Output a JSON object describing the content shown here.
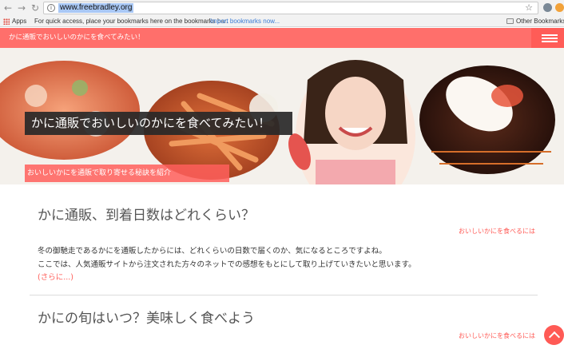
{
  "browser": {
    "url": "www.freebradley.org",
    "back_icon": "arrow-left-icon",
    "forward_icon": "arrow-right-icon",
    "reload_icon": "reload-icon",
    "info_icon": "info-icon",
    "star_icon": "star-icon"
  },
  "bookmarks": {
    "apps_label": "Apps",
    "hint": "For quick access, place your bookmarks here on the bookmarks bar.",
    "import_link": "Import bookmarks now...",
    "other_label": "Other Bookmarks"
  },
  "site": {
    "header_title": "かに通販でおいしいのかにを食べてみたい！",
    "menu_icon": "hamburger-menu-icon",
    "accent_color": "#ff6f6b"
  },
  "hero": {
    "title": "かに通販でおいしいのかにを食べてみたい！",
    "subtitle": "おいしいかにを通販で取り寄せる秘訣を紹介"
  },
  "articles": [
    {
      "title": "かに通販、到着日数はどれくらい？",
      "category": "おいしいかにを食べるには",
      "lines": [
        "冬の御馳走であるかにを通販したからには、どれくらいの日数で届くのか、気になるところですよね。",
        "ここでは、人気通販サイトから注文された方々のネットでの感想をもとにして取り上げていきたいと思います。"
      ],
      "more": "(さらに...)"
    },
    {
      "title": "かにの旬はいつ？美味しく食べよう",
      "category": "おいしいかにを食べるには"
    }
  ]
}
